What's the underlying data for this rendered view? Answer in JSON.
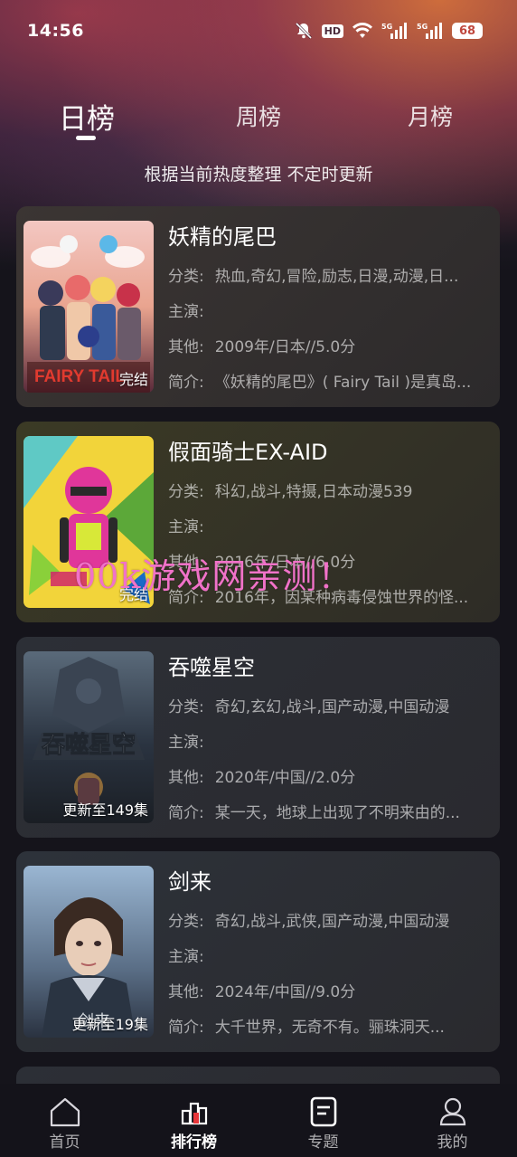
{
  "status": {
    "time": "14:56",
    "hd_label": "HD",
    "network_1": "5G",
    "network_2": "5G",
    "battery": "68"
  },
  "tabs": [
    {
      "label": "日榜",
      "active": true
    },
    {
      "label": "周榜",
      "active": false
    },
    {
      "label": "月榜",
      "active": false
    }
  ],
  "subtitle": "根据当前热度整理 不定时更新",
  "field_labels": {
    "category": "分类:",
    "cast": "主演:",
    "other": "其他:",
    "intro": "简介:"
  },
  "items": [
    {
      "title": "妖精的尾巴",
      "category": "热血,奇幻,冒险,励志,日漫,动漫,日...",
      "cast": "",
      "other": "2009年/日本//5.0分",
      "intro": "《妖精的尾巴》( Fairy Tail )是真岛...",
      "badge": "完结",
      "poster_logo": "FAIRY TAIL"
    },
    {
      "title": "假面骑士EX-AID",
      "category": "科幻,战斗,特摄,日本动漫539",
      "cast": "",
      "other": "2016年/日本//6.0分",
      "intro": "2016年，因某种病毒侵蚀世界的怪...",
      "badge": "完结",
      "poster_logo": ""
    },
    {
      "title": "吞噬星空",
      "category": "奇幻,玄幻,战斗,国产动漫,中国动漫",
      "cast": "",
      "other": "2020年/中国//2.0分",
      "intro": "某一天，地球上出现了不明来由的...",
      "badge": "更新至149集",
      "poster_logo": "吞噬星空"
    },
    {
      "title": "剑来",
      "category": "奇幻,战斗,武侠,国产动漫,中国动漫",
      "cast": "",
      "other": "2024年/中国//9.0分",
      "intro": "大千世界，无奇不有。骊珠洞天...",
      "badge": "更新至19集",
      "poster_logo": "剑来"
    }
  ],
  "watermark": "00k游戏网亲测！",
  "bottom_nav": [
    {
      "label": "首页",
      "icon": "home-icon",
      "active": false
    },
    {
      "label": "排行榜",
      "icon": "ranking-icon",
      "active": true
    },
    {
      "label": "专题",
      "icon": "topic-icon",
      "active": false
    },
    {
      "label": "我的",
      "icon": "profile-icon",
      "active": false
    }
  ],
  "colors": {
    "background": "#15141b",
    "card": "#2d2b2e",
    "watermark": "#f072c8",
    "text_secondary": "#9a989c"
  }
}
